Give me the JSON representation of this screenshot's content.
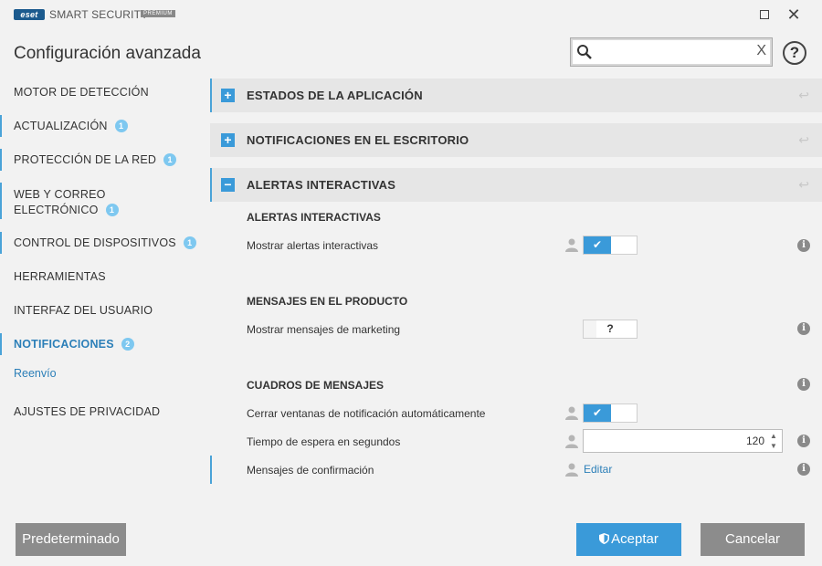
{
  "window": {
    "logo_text": "eset",
    "product_name": "SMART SECURITY",
    "edition": "PREMIUM"
  },
  "header": {
    "title": "Configuración avanzada",
    "search": {
      "value": "",
      "placeholder": "",
      "clear_symbol": "X"
    },
    "help_symbol": "?"
  },
  "sidebar": {
    "items": [
      {
        "label": "MOTOR DE DETECCIÓN",
        "badge": ""
      },
      {
        "label": "ACTUALIZACIÓN",
        "badge": "1"
      },
      {
        "label": "PROTECCIÓN DE LA RED",
        "badge": "1"
      },
      {
        "label": "WEB Y CORREO",
        "label2": "ELECTRÓNICO",
        "badge": "1"
      },
      {
        "label": "CONTROL DE DISPOSITIVOS",
        "badge": "1"
      },
      {
        "label": "HERRAMIENTAS",
        "badge": ""
      },
      {
        "label": "INTERFAZ DEL USUARIO",
        "badge": ""
      },
      {
        "label": "NOTIFICACIONES",
        "badge": "2"
      },
      {
        "label": "AJUSTES DE PRIVACIDAD",
        "badge": ""
      }
    ],
    "sub_item": "Reenvío"
  },
  "sections": [
    {
      "title": "ESTADOS DE LA APLICACIÓN",
      "expanded": false,
      "symbol": "+"
    },
    {
      "title": "NOTIFICACIONES EN EL ESCRITORIO",
      "expanded": false,
      "symbol": "+"
    },
    {
      "title": "ALERTAS INTERACTIVAS",
      "expanded": true,
      "symbol": "−"
    }
  ],
  "content": {
    "group1": {
      "heading": "ALERTAS INTERACTIVAS",
      "rows": [
        {
          "label": "Mostrar alertas interactivas",
          "state": "on"
        }
      ]
    },
    "group2": {
      "heading": "MENSAJES EN EL PRODUCTO",
      "rows": [
        {
          "label": "Mostrar mensajes de marketing",
          "state": "?"
        }
      ]
    },
    "group3": {
      "heading": "CUADROS DE MENSAJES",
      "rows": [
        {
          "label": "Cerrar ventanas de notificación automáticamente",
          "state": "on"
        },
        {
          "label": "Tiempo de espera en segundos",
          "value": "120"
        },
        {
          "label": "Mensajes de confirmación",
          "link": "Editar"
        }
      ]
    },
    "check_symbol": "✔",
    "info_symbol": "i"
  },
  "footer": {
    "default_label": "Predeterminado",
    "accept_label": "Aceptar",
    "cancel_label": "Cancelar"
  },
  "colors": {
    "accent": "#3a9ad9",
    "badge": "#7ec8f0",
    "link": "#2c7fb8",
    "button_gray": "#8c8c8c",
    "background": "#f2f2f2"
  },
  "icons": [
    "search-icon",
    "close-icon",
    "help-icon",
    "maximize-icon",
    "expand-icon",
    "collapse-icon",
    "revert-icon",
    "user-icon",
    "info-icon",
    "shield-icon",
    "chevron-up-icon",
    "chevron-down-icon"
  ]
}
